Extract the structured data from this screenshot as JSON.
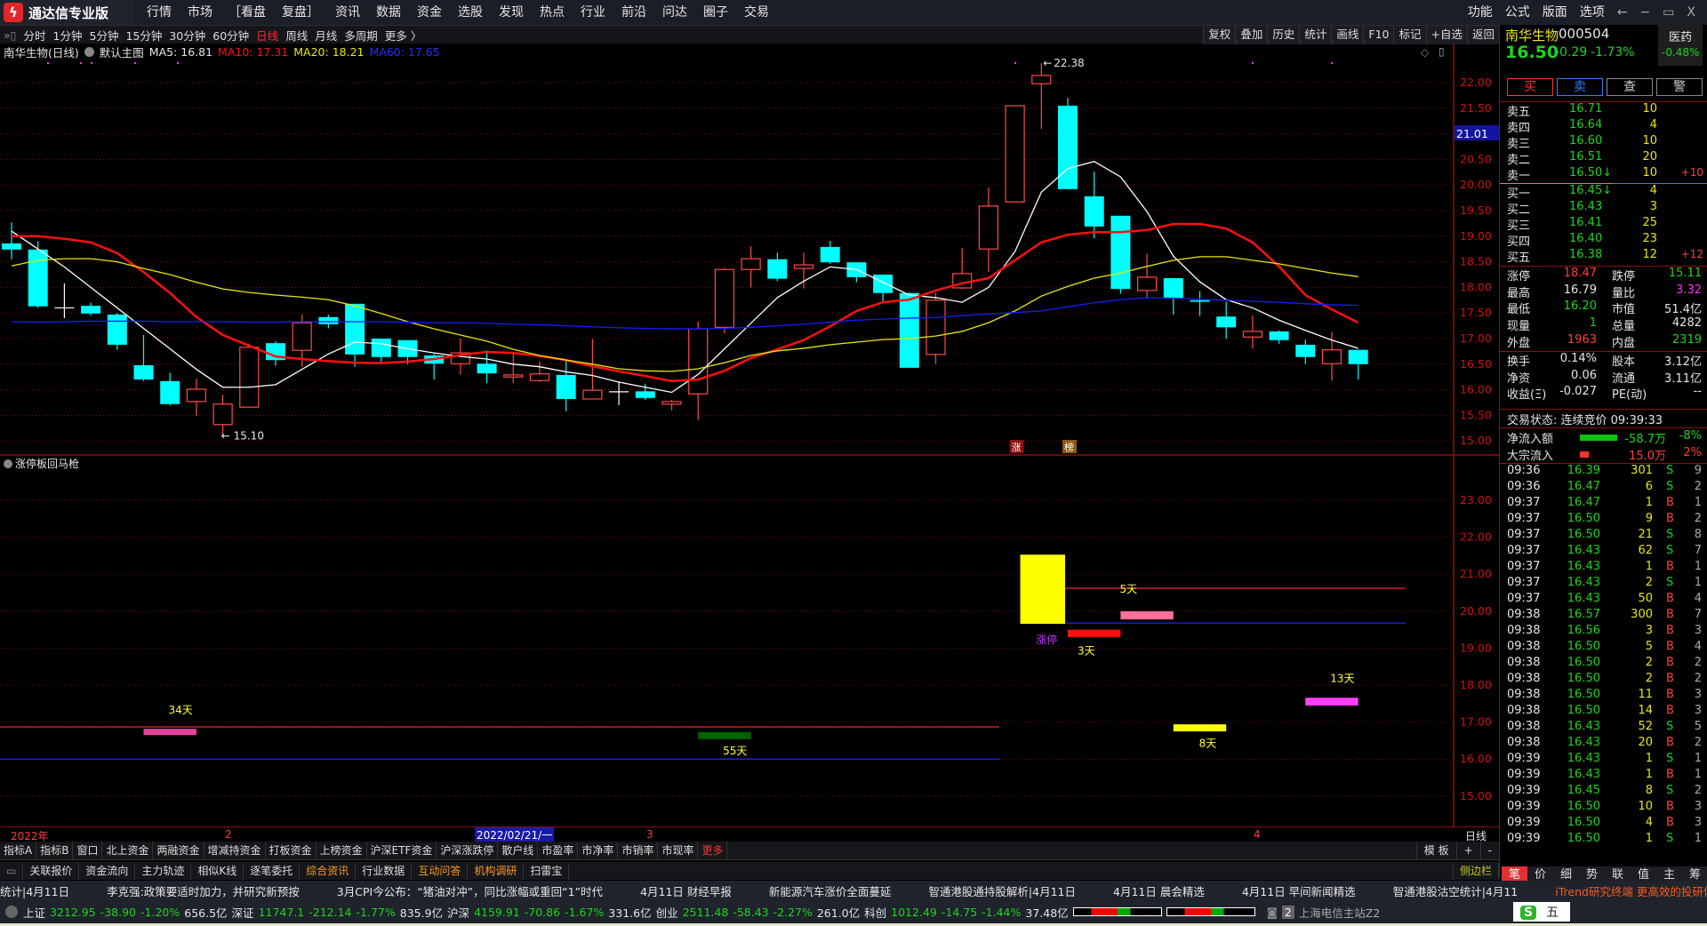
{
  "app": {
    "title": "通达信专业版",
    "logo_icon": "tdx-logo-icon"
  },
  "menu": [
    "行情",
    "市场",
    "［看盘",
    "复盘］",
    "资讯",
    "数据",
    "资金",
    "选股",
    "发现",
    "热点",
    "行业",
    "前沿",
    "问达",
    "圈子",
    "交易"
  ],
  "menu_right": [
    "功能",
    "公式",
    "版面",
    "选项"
  ],
  "window_controls": [
    "←",
    "−",
    "▭",
    "X"
  ],
  "periods": [
    "分时",
    "1分钟",
    "5分钟",
    "15分钟",
    "30分钟",
    "60分钟",
    "日线",
    "周线",
    "月线",
    "多周期",
    "更多 〉"
  ],
  "selected_period": "日线",
  "chart_tools": [
    "复权",
    "叠加",
    "历史",
    "统计",
    "画线",
    "F10",
    "标记",
    "+自选",
    "返回"
  ],
  "chart_header": {
    "name": "南华生物(日线)",
    "template": "默认主图",
    "ma5": "MA5: 16.81",
    "ma10": "MA10: 17.31",
    "ma20": "MA20: 18.21",
    "ma60": "MA60: 17.65"
  },
  "indicator_name": "涨停板回马枪",
  "chart_data": {
    "type": "candlestick",
    "price_axis": {
      "ylim": [
        14.8,
        22.6
      ],
      "ticks": [
        "22.00",
        "21.50",
        "21.00",
        "20.50",
        "20.00",
        "19.50",
        "19.00",
        "18.50",
        "18.00",
        "17.50",
        "17.00",
        "16.50",
        "16.00",
        "15.50",
        "15.00"
      ],
      "cursor_label": "21.01"
    },
    "high_label": "22.38",
    "low_label": "15.10",
    "candles": [
      [
        18.86,
        19.27,
        18.55,
        18.74
      ],
      [
        18.74,
        18.9,
        17.6,
        17.63
      ],
      [
        17.6,
        18.08,
        17.4,
        17.6
      ],
      [
        17.64,
        17.7,
        17.45,
        17.49
      ],
      [
        17.47,
        17.5,
        16.78,
        16.88
      ],
      [
        16.48,
        17.07,
        16.17,
        16.2
      ],
      [
        16.17,
        16.33,
        15.69,
        15.72
      ],
      [
        15.77,
        16.22,
        15.49,
        16.01
      ],
      [
        15.32,
        15.9,
        15.1,
        15.72
      ],
      [
        15.66,
        16.9,
        15.66,
        16.83
      ],
      [
        16.91,
        16.95,
        16.47,
        16.58
      ],
      [
        16.77,
        17.47,
        16.45,
        17.31
      ],
      [
        17.42,
        17.47,
        17.2,
        17.28
      ],
      [
        17.68,
        17.68,
        16.45,
        16.69
      ],
      [
        17.0,
        17.0,
        16.52,
        16.64
      ],
      [
        16.97,
        16.97,
        16.5,
        16.64
      ],
      [
        16.67,
        16.7,
        16.2,
        16.51
      ],
      [
        16.51,
        17.0,
        16.3,
        16.72
      ],
      [
        16.51,
        16.77,
        16.13,
        16.32
      ],
      [
        16.25,
        16.74,
        16.13,
        16.29
      ],
      [
        16.18,
        16.55,
        16.15,
        16.31
      ],
      [
        16.29,
        16.57,
        15.58,
        15.82
      ],
      [
        15.82,
        16.99,
        15.82,
        15.99
      ],
      [
        15.96,
        16.16,
        15.7,
        15.96
      ],
      [
        15.97,
        16.12,
        15.8,
        15.84
      ],
      [
        15.72,
        15.8,
        15.6,
        15.77
      ],
      [
        15.92,
        17.33,
        15.41,
        17.19
      ],
      [
        17.22,
        18.38,
        17.1,
        18.35
      ],
      [
        18.35,
        18.8,
        18.0,
        18.56
      ],
      [
        18.55,
        18.68,
        18.12,
        18.17
      ],
      [
        18.37,
        18.68,
        17.98,
        18.44
      ],
      [
        18.79,
        18.91,
        18.46,
        18.49
      ],
      [
        18.49,
        18.49,
        18.1,
        18.2
      ],
      [
        18.25,
        18.25,
        17.7,
        17.89
      ],
      [
        17.89,
        17.9,
        16.43,
        16.43
      ],
      [
        16.69,
        17.9,
        16.5,
        17.75
      ],
      [
        17.99,
        18.77,
        17.97,
        18.27
      ],
      [
        18.75,
        19.95,
        18.3,
        19.59
      ],
      [
        19.67,
        21.55,
        19.67,
        21.55
      ],
      [
        21.98,
        22.38,
        21.1,
        22.14
      ],
      [
        21.55,
        21.7,
        19.92,
        19.92
      ],
      [
        19.78,
        20.26,
        18.96,
        19.19
      ],
      [
        19.4,
        19.4,
        17.88,
        17.97
      ],
      [
        17.94,
        18.66,
        17.78,
        18.2
      ],
      [
        18.18,
        18.18,
        17.47,
        17.78
      ],
      [
        17.75,
        17.93,
        17.44,
        17.72
      ],
      [
        17.43,
        17.72,
        17.0,
        17.22
      ],
      [
        17.03,
        17.45,
        16.8,
        17.14
      ],
      [
        17.14,
        17.16,
        16.9,
        16.97
      ],
      [
        16.88,
        16.98,
        16.5,
        16.64
      ],
      [
        16.51,
        17.13,
        16.18,
        16.78
      ],
      [
        16.78,
        16.78,
        16.2,
        16.5
      ]
    ],
    "ma": [
      {
        "name": "MA5",
        "color": "#ffffff",
        "values": [
          19.1,
          18.75,
          18.4,
          18.0,
          17.6,
          17.2,
          16.8,
          16.4,
          16.05,
          16.05,
          16.1,
          16.4,
          16.7,
          16.93,
          16.9,
          16.8,
          16.72,
          16.65,
          16.6,
          16.5,
          16.45,
          16.35,
          16.28,
          16.15,
          16.05,
          15.95,
          16.3,
          16.8,
          17.3,
          17.8,
          18.12,
          18.4,
          18.35,
          18.1,
          17.85,
          17.8,
          17.71,
          18.0,
          18.7,
          19.86,
          20.32,
          20.46,
          20.16,
          19.48,
          18.61,
          18.11,
          17.76,
          17.6,
          17.36,
          17.16,
          16.97,
          16.81
        ]
      },
      {
        "name": "MA10",
        "color": "#ff1010",
        "values": [
          19.0,
          19.0,
          18.95,
          18.88,
          18.67,
          18.3,
          17.89,
          17.42,
          17.07,
          16.86,
          16.65,
          16.6,
          16.56,
          16.53,
          16.52,
          16.55,
          16.6,
          16.68,
          16.74,
          16.72,
          16.66,
          16.58,
          16.46,
          16.36,
          16.27,
          16.17,
          16.2,
          16.37,
          16.62,
          16.79,
          16.97,
          17.24,
          17.54,
          17.71,
          17.76,
          17.94,
          18.08,
          18.18,
          18.53,
          18.88,
          19.03,
          19.08,
          19.08,
          19.12,
          19.24,
          19.24,
          19.15,
          18.88,
          18.41,
          17.85,
          17.57,
          17.31
        ]
      },
      {
        "name": "MA20",
        "color": "#e8e800",
        "values": [
          18.42,
          18.53,
          18.56,
          18.56,
          18.5,
          18.37,
          18.25,
          18.1,
          17.97,
          17.9,
          17.85,
          17.81,
          17.76,
          17.64,
          17.49,
          17.33,
          17.19,
          17.07,
          16.95,
          16.79,
          16.67,
          16.58,
          16.5,
          16.41,
          16.37,
          16.36,
          16.41,
          16.53,
          16.67,
          16.76,
          16.81,
          16.88,
          16.93,
          16.98,
          17.0,
          17.05,
          17.14,
          17.31,
          17.54,
          17.83,
          18.02,
          18.18,
          18.28,
          18.41,
          18.53,
          18.6,
          18.6,
          18.53,
          18.46,
          18.37,
          18.28,
          18.21
        ]
      },
      {
        "name": "MA60",
        "color": "#1020ff",
        "values": [
          17.33,
          17.32,
          17.33,
          17.34,
          17.34,
          17.34,
          17.33,
          17.33,
          17.33,
          17.32,
          17.32,
          17.33,
          17.33,
          17.33,
          17.33,
          17.32,
          17.31,
          17.31,
          17.3,
          17.28,
          17.27,
          17.25,
          17.23,
          17.21,
          17.2,
          17.19,
          17.19,
          17.2,
          17.22,
          17.25,
          17.28,
          17.32,
          17.36,
          17.38,
          17.4,
          17.41,
          17.45,
          17.48,
          17.51,
          17.54,
          17.62,
          17.7,
          17.76,
          17.8,
          17.79,
          17.77,
          17.75,
          17.73,
          17.71,
          17.68,
          17.66,
          17.65
        ]
      }
    ],
    "markers": [
      {
        "label": "涨",
        "candle": 39,
        "color": "#8b1010"
      },
      {
        "label": "榜",
        "candle": 41,
        "color": "#8b5a10"
      }
    ],
    "indicator": {
      "ylim": [
        14.2,
        24.0
      ],
      "ticks": [
        "23.00",
        "22.00",
        "21.00",
        "20.00",
        "19.00",
        "18.00",
        "17.00",
        "16.00",
        "15.00"
      ],
      "lines": [
        {
          "price": 16.87,
          "from": -0.5,
          "to": 37.4,
          "color": "#ff2020"
        },
        {
          "price": 16.0,
          "from": -0.5,
          "to": 37.4,
          "color": "#2020ff"
        },
        {
          "price": 20.62,
          "from": 39.9,
          "to": 52.8,
          "color": "#ff2020"
        },
        {
          "price": 19.68,
          "from": 39.9,
          "to": 52.8,
          "color": "#2020ff"
        }
      ],
      "boxes": [
        {
          "from": 38.2,
          "to": 39.9,
          "top": 21.53,
          "bottom": 19.66,
          "color": "#ffff00"
        },
        {
          "from": 5.0,
          "to": 7.0,
          "top": 16.82,
          "bottom": 16.65,
          "color": "#e0409a"
        },
        {
          "from": 26.0,
          "to": 28.0,
          "top": 16.73,
          "bottom": 16.54,
          "color": "#006400"
        },
        {
          "from": 40.0,
          "to": 42.0,
          "top": 19.5,
          "bottom": 19.3,
          "color": "#ff1010"
        },
        {
          "from": 42.0,
          "to": 44.0,
          "top": 20.0,
          "bottom": 19.78,
          "color": "#ff7098"
        },
        {
          "from": 44.0,
          "to": 46.0,
          "top": 16.94,
          "bottom": 16.75,
          "color": "#ffff00"
        },
        {
          "from": 49.0,
          "to": 51.0,
          "top": 17.66,
          "bottom": 17.45,
          "color": "#ff40ff"
        }
      ],
      "labels": [
        {
          "text": "34天",
          "candle": 6.4,
          "price": 17.35,
          "color": "#ffff30"
        },
        {
          "text": "55天",
          "candle": 27.4,
          "price": 16.25,
          "color": "#ffff30"
        },
        {
          "text": "涨停",
          "candle": 39.2,
          "price": 19.25,
          "color": "#c030ff"
        },
        {
          "text": "3天",
          "candle": 40.7,
          "price": 18.95,
          "color": "#ffff30"
        },
        {
          "text": "5天",
          "candle": 42.3,
          "price": 20.62,
          "color": "#ffff30"
        },
        {
          "text": "8天",
          "candle": 45.3,
          "price": 16.45,
          "color": "#ffff30"
        },
        {
          "text": "13天",
          "candle": 50.4,
          "price": 18.2,
          "color": "#ffff30"
        }
      ]
    }
  },
  "dates": {
    "year": "2022年",
    "feb": "2",
    "cursor": "2022/02/21/一",
    "mar": "3",
    "apr": "4",
    "period": "日线"
  },
  "quote": {
    "name": "南华生物",
    "code": "000504",
    "sector": "医药",
    "sector_change": "-0.48%",
    "price": "16.50",
    "change": "-0.29",
    "pct": "-1.73%",
    "buttons": [
      "买",
      "卖",
      "查",
      "警"
    ],
    "asks": [
      {
        "l": "卖五",
        "p": "16.71",
        "v": "10",
        "d": ""
      },
      {
        "l": "卖四",
        "p": "16.64",
        "v": "4",
        "d": ""
      },
      {
        "l": "卖三",
        "p": "16.60",
        "v": "10",
        "d": ""
      },
      {
        "l": "卖二",
        "p": "16.51",
        "v": "20",
        "d": ""
      },
      {
        "l": "卖一",
        "p": "16.50↓",
        "v": "10",
        "d": "+10"
      }
    ],
    "bids": [
      {
        "l": "买一",
        "p": "16.45↓",
        "v": "4",
        "d": ""
      },
      {
        "l": "买二",
        "p": "16.43",
        "v": "3",
        "d": ""
      },
      {
        "l": "买三",
        "p": "16.41",
        "v": "25",
        "d": ""
      },
      {
        "l": "买四",
        "p": "16.40",
        "v": "23",
        "d": ""
      },
      {
        "l": "买五",
        "p": "16.38",
        "v": "12",
        "d": "+12"
      }
    ],
    "stats": [
      {
        "l1": "涨停",
        "v1": "18.47",
        "c1": "rd",
        "l2": "跌停",
        "v2": "15.11",
        "c2": "g"
      },
      {
        "l1": "最高",
        "v1": "16.79",
        "c1": "w",
        "l2": "量比",
        "v2": "3.32",
        "c2": "m"
      },
      {
        "l1": "最低",
        "v1": "16.20",
        "c1": "g",
        "l2": "市值",
        "v2": "51.4亿",
        "c2": "w"
      },
      {
        "l1": "现量",
        "v1": "1",
        "c1": "g",
        "l2": "总量",
        "v2": "4282",
        "c2": "w"
      },
      {
        "l1": "外盘",
        "v1": "1963",
        "c1": "rd",
        "l2": "内盘",
        "v2": "2319",
        "c2": "g"
      }
    ],
    "stats2": [
      {
        "l1": "换手",
        "v1": "0.14%",
        "c1": "w",
        "l2": "股本",
        "v2": "3.12亿",
        "c2": "w"
      },
      {
        "l1": "净资",
        "v1": "0.06",
        "c1": "w",
        "l2": "流通",
        "v2": "3.11亿",
        "c2": "w"
      },
      {
        "l1": "收益(Ξ)",
        "v1": "-0.027",
        "c1": "w",
        "l2": "PE(动)",
        "v2": "--",
        "c2": "w"
      }
    ],
    "trade_status": "交易状态: 连续竞价 09:39:33",
    "net_inflow": {
      "label": "净流入额",
      "value": "-58.7万",
      "pct": "-8%"
    },
    "block_inflow": {
      "label": "大宗流入",
      "value": "15.0万",
      "pct": "2%"
    },
    "trades": [
      [
        "09:36",
        "16.39",
        "301",
        "S",
        "9"
      ],
      [
        "09:36",
        "16.47",
        "6",
        "S",
        "2"
      ],
      [
        "09:37",
        "16.47",
        "1",
        "B",
        "1"
      ],
      [
        "09:37",
        "16.50",
        "9",
        "B",
        "2"
      ],
      [
        "09:37",
        "16.50",
        "21",
        "S",
        "8"
      ],
      [
        "09:37",
        "16.43",
        "62",
        "S",
        "7"
      ],
      [
        "09:37",
        "16.43",
        "1",
        "B",
        "1"
      ],
      [
        "09:37",
        "16.43",
        "2",
        "S",
        "1"
      ],
      [
        "09:37",
        "16.43",
        "50",
        "B",
        "4"
      ],
      [
        "09:38",
        "16.57",
        "300",
        "B",
        "7"
      ],
      [
        "09:38",
        "16.56",
        "3",
        "B",
        "3"
      ],
      [
        "09:38",
        "16.50",
        "5",
        "B",
        "4"
      ],
      [
        "09:38",
        "16.50",
        "2",
        "B",
        "2"
      ],
      [
        "09:38",
        "16.50",
        "2",
        "B",
        "2"
      ],
      [
        "09:38",
        "16.50",
        "11",
        "B",
        "3"
      ],
      [
        "09:38",
        "16.50",
        "14",
        "B",
        "3"
      ],
      [
        "09:38",
        "16.43",
        "52",
        "S",
        "5"
      ],
      [
        "09:38",
        "16.43",
        "20",
        "B",
        "2"
      ],
      [
        "09:39",
        "16.43",
        "1",
        "S",
        "1"
      ],
      [
        "09:39",
        "16.43",
        "1",
        "B",
        "1"
      ],
      [
        "09:39",
        "16.45",
        "8",
        "S",
        "2"
      ],
      [
        "09:39",
        "16.50",
        "10",
        "B",
        "3"
      ],
      [
        "09:39",
        "16.50",
        "4",
        "B",
        "3"
      ],
      [
        "09:39",
        "16.50",
        "1",
        "S",
        "1"
      ]
    ],
    "tabs": [
      "笔",
      "价",
      "细",
      "势",
      "联",
      "值",
      "主",
      "筹"
    ]
  },
  "bottom_tabs": [
    "指标A",
    "指标B",
    "窗口",
    "北上资金",
    "两融资金",
    "增减持资金",
    "打板资金",
    "上榜资金",
    "沪深ETF资金",
    "沪深涨跌停",
    "散户线",
    "市盈率",
    "市净率",
    "市销率",
    "市现率",
    "更多"
  ],
  "bottom_tabs_right": [
    "模 板",
    "+",
    "-"
  ],
  "info_tabs": [
    "关联报价",
    "资金流向",
    "主力轨迹",
    "相似K线",
    "逐笔委托",
    "综合资讯",
    "行业数据",
    "互动问答",
    "机构调研",
    "扫雷宝"
  ],
  "sidebar_toggle": "侧边栏",
  "news": [
    "统计|4月11日",
    "李克强:政策要适时加力，并研究新预按",
    "3月CPI今公布：“猪油对冲”，同比涨幅或重回“1”时代",
    "4月11日 财经早报",
    "新能源汽车涨价全面蔓延",
    "智通港股通持股解析|4月11日",
    "4月11日 晨会精选",
    "4月11日 早间新闻精选",
    "智通港股沽空统计|4月11"
  ],
  "news_ad": "iTrend研究终端 更高效的投研体验",
  "indices": [
    {
      "name": "上证",
      "val": "3212.95",
      "chg": "-38.90",
      "pct": "-1.20%",
      "amt": "656.5亿"
    },
    {
      "name": "深证",
      "val": "11747.1",
      "chg": "-212.14",
      "pct": "-1.77%",
      "amt": "835.9亿"
    },
    {
      "name": "沪深",
      "val": "4159.91",
      "chg": "-70.86",
      "pct": "-1.67%",
      "amt": "331.6亿"
    },
    {
      "name": "创业",
      "val": "2511.48",
      "chg": "-58.43",
      "pct": "-2.27%",
      "amt": "261.0亿"
    },
    {
      "name": "科创",
      "val": "1012.49",
      "chg": "-14.75",
      "pct": "-1.44%",
      "amt": "37.48亿"
    }
  ],
  "server": {
    "num": "2",
    "name": "上海电信主站Z2"
  },
  "ime": {
    "label": "五"
  }
}
